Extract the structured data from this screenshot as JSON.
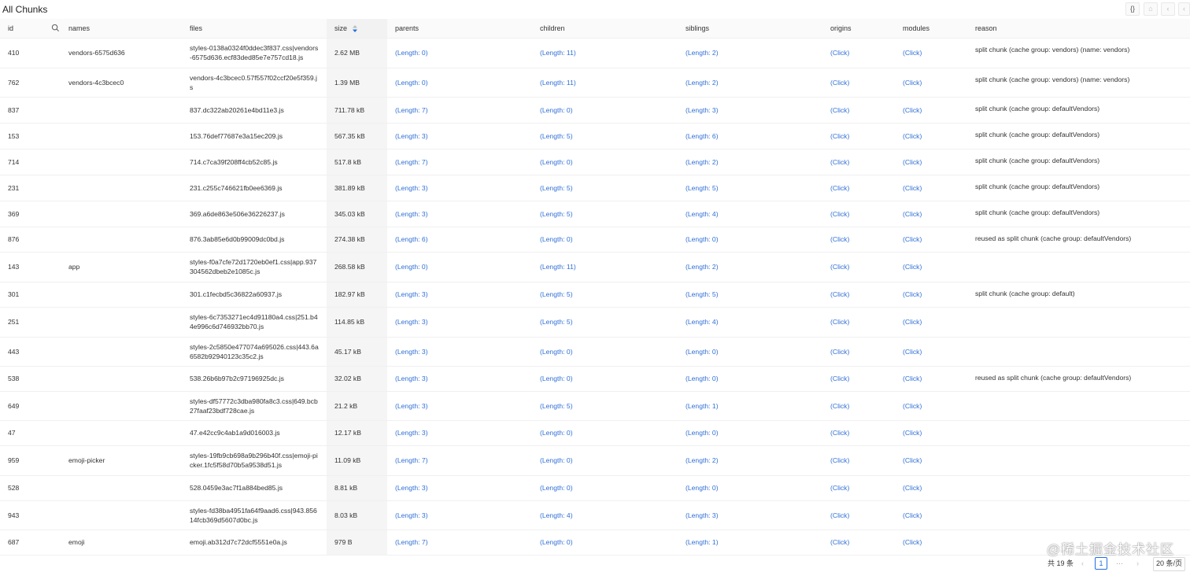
{
  "title": "All Chunks",
  "toolbar": {
    "icon1": "{}",
    "icon2": "⌂",
    "icon3": "‹",
    "icon4": "‹"
  },
  "columns": {
    "id": "id",
    "names": "names",
    "files": "files",
    "size": "size",
    "parents": "parents",
    "children": "children",
    "siblings": "siblings",
    "origins": "origins",
    "modules": "modules",
    "reason": "reason"
  },
  "rows": [
    {
      "id": "410",
      "names": "vendors-6575d636",
      "files": "styles-0138a0324f0ddec3f837.css|vendors-6575d636.ecf83ded85e7e757cd18.js",
      "size": "2.62 MB",
      "parents": "(Length: 0)",
      "children": "(Length: 11)",
      "siblings": "(Length: 2)",
      "origins": "(Click)",
      "modules": "(Click)",
      "reason": "split chunk (cache group: vendors) (name: vendors)"
    },
    {
      "id": "762",
      "names": "vendors-4c3bcec0",
      "files": "vendors-4c3bcec0.57f557f02ccf20e5f359.js",
      "size": "1.39 MB",
      "parents": "(Length: 0)",
      "children": "(Length: 11)",
      "siblings": "(Length: 2)",
      "origins": "(Click)",
      "modules": "(Click)",
      "reason": "split chunk (cache group: vendors) (name: vendors)"
    },
    {
      "id": "837",
      "names": "",
      "files": "837.dc322ab20261e4bd11e3.js",
      "size": "711.78 kB",
      "parents": "(Length: 7)",
      "children": "(Length: 0)",
      "siblings": "(Length: 3)",
      "origins": "(Click)",
      "modules": "(Click)",
      "reason": "split chunk (cache group: defaultVendors)"
    },
    {
      "id": "153",
      "names": "",
      "files": "153.76def77687e3a15ec209.js",
      "size": "567.35 kB",
      "parents": "(Length: 3)",
      "children": "(Length: 5)",
      "siblings": "(Length: 6)",
      "origins": "(Click)",
      "modules": "(Click)",
      "reason": "split chunk (cache group: defaultVendors)"
    },
    {
      "id": "714",
      "names": "",
      "files": "714.c7ca39f208ff4cb52c85.js",
      "size": "517.8 kB",
      "parents": "(Length: 7)",
      "children": "(Length: 0)",
      "siblings": "(Length: 2)",
      "origins": "(Click)",
      "modules": "(Click)",
      "reason": "split chunk (cache group: defaultVendors)"
    },
    {
      "id": "231",
      "names": "",
      "files": "231.c255c746621fb0ee6369.js",
      "size": "381.89 kB",
      "parents": "(Length: 3)",
      "children": "(Length: 5)",
      "siblings": "(Length: 5)",
      "origins": "(Click)",
      "modules": "(Click)",
      "reason": "split chunk (cache group: defaultVendors)"
    },
    {
      "id": "369",
      "names": "",
      "files": "369.a6de863e506e36226237.js",
      "size": "345.03 kB",
      "parents": "(Length: 3)",
      "children": "(Length: 5)",
      "siblings": "(Length: 4)",
      "origins": "(Click)",
      "modules": "(Click)",
      "reason": "split chunk (cache group: defaultVendors)"
    },
    {
      "id": "876",
      "names": "",
      "files": "876.3ab85e6d0b99009dc0bd.js",
      "size": "274.38 kB",
      "parents": "(Length: 6)",
      "children": "(Length: 0)",
      "siblings": "(Length: 0)",
      "origins": "(Click)",
      "modules": "(Click)",
      "reason": "reused as split chunk (cache group: defaultVendors)"
    },
    {
      "id": "143",
      "names": "app",
      "files": "styles-f0a7cfe72d1720eb0ef1.css|app.937304562dbeb2e1085c.js",
      "size": "268.58 kB",
      "parents": "(Length: 0)",
      "children": "(Length: 11)",
      "siblings": "(Length: 2)",
      "origins": "(Click)",
      "modules": "(Click)",
      "reason": ""
    },
    {
      "id": "301",
      "names": "",
      "files": "301.c1fecbd5c36822a60937.js",
      "size": "182.97 kB",
      "parents": "(Length: 3)",
      "children": "(Length: 5)",
      "siblings": "(Length: 5)",
      "origins": "(Click)",
      "modules": "(Click)",
      "reason": "split chunk (cache group: default)"
    },
    {
      "id": "251",
      "names": "",
      "files": "styles-6c7353271ec4d91180a4.css|251.b44e996c6d746932bb70.js",
      "size": "114.85 kB",
      "parents": "(Length: 3)",
      "children": "(Length: 5)",
      "siblings": "(Length: 4)",
      "origins": "(Click)",
      "modules": "(Click)",
      "reason": ""
    },
    {
      "id": "443",
      "names": "",
      "files": "styles-2c5850e477074a695026.css|443.6a6582b92940123c35c2.js",
      "size": "45.17 kB",
      "parents": "(Length: 3)",
      "children": "(Length: 0)",
      "siblings": "(Length: 0)",
      "origins": "(Click)",
      "modules": "(Click)",
      "reason": ""
    },
    {
      "id": "538",
      "names": "",
      "files": "538.26b6b97b2c97196925dc.js",
      "size": "32.02 kB",
      "parents": "(Length: 3)",
      "children": "(Length: 0)",
      "siblings": "(Length: 0)",
      "origins": "(Click)",
      "modules": "(Click)",
      "reason": "reused as split chunk (cache group: defaultVendors)"
    },
    {
      "id": "649",
      "names": "",
      "files": "styles-df57772c3dba980fa8c3.css|649.bcb27faaf23bdf728cae.js",
      "size": "21.2 kB",
      "parents": "(Length: 3)",
      "children": "(Length: 5)",
      "siblings": "(Length: 1)",
      "origins": "(Click)",
      "modules": "(Click)",
      "reason": ""
    },
    {
      "id": "47",
      "names": "",
      "files": "47.e42cc9c4ab1a9d016003.js",
      "size": "12.17 kB",
      "parents": "(Length: 3)",
      "children": "(Length: 0)",
      "siblings": "(Length: 0)",
      "origins": "(Click)",
      "modules": "(Click)",
      "reason": ""
    },
    {
      "id": "959",
      "names": "emoji-picker",
      "files": "styles-19fb9cb698a9b296b40f.css|emoji-picker.1fc5f58d70b5a9538d51.js",
      "size": "11.09 kB",
      "parents": "(Length: 7)",
      "children": "(Length: 0)",
      "siblings": "(Length: 2)",
      "origins": "(Click)",
      "modules": "(Click)",
      "reason": ""
    },
    {
      "id": "528",
      "names": "",
      "files": "528.0459e3ac7f1a884bed85.js",
      "size": "8.81 kB",
      "parents": "(Length: 3)",
      "children": "(Length: 0)",
      "siblings": "(Length: 0)",
      "origins": "(Click)",
      "modules": "(Click)",
      "reason": ""
    },
    {
      "id": "943",
      "names": "",
      "files": "styles-fd38ba4951fa64f9aad6.css|943.85614fcb369d5607d0bc.js",
      "size": "8.03 kB",
      "parents": "(Length: 3)",
      "children": "(Length: 4)",
      "siblings": "(Length: 3)",
      "origins": "(Click)",
      "modules": "(Click)",
      "reason": ""
    },
    {
      "id": "687",
      "names": "emoji",
      "files": "emoji.ab312d7c72dcf5551e0a.js",
      "size": "979 B",
      "parents": "(Length: 7)",
      "children": "(Length: 0)",
      "siblings": "(Length: 1)",
      "origins": "(Click)",
      "modules": "(Click)",
      "reason": ""
    }
  ],
  "pagination": {
    "total": "共 19 条",
    "prev": "‹",
    "current": "1",
    "ellipsis": "···",
    "next": "›",
    "page_size": "20 条/页"
  },
  "watermark": "@稀土掘金技术社区"
}
